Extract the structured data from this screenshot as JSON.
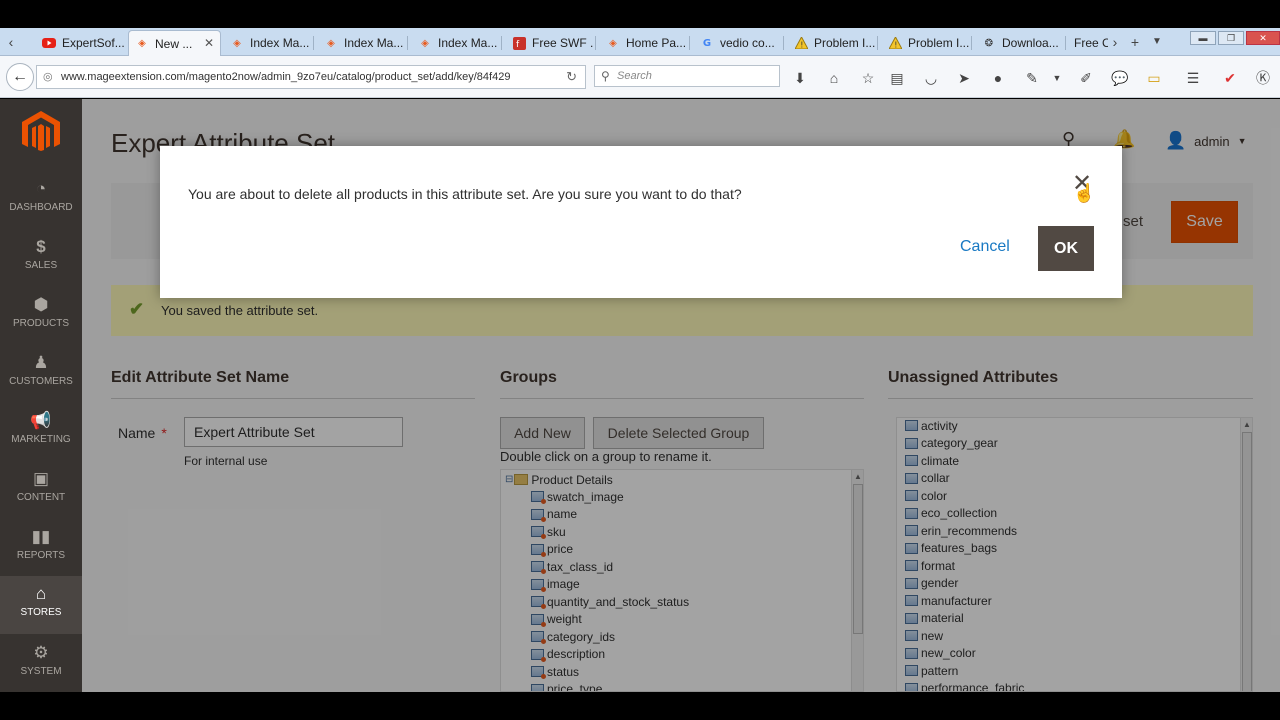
{
  "browser": {
    "tabs": [
      {
        "label": "ExpertSof...",
        "icon": "youtube-icon"
      },
      {
        "label": "New ...",
        "icon": "magento-icon"
      },
      {
        "label": "Index Ma...",
        "icon": "magento-icon"
      },
      {
        "label": "Index Ma...",
        "icon": "magento-icon"
      },
      {
        "label": "Index Ma...",
        "icon": "magento-icon"
      },
      {
        "label": "Free SWF ...",
        "icon": "flash-icon"
      },
      {
        "label": "Home Pa...",
        "icon": "magento-icon"
      },
      {
        "label": "vedio co...",
        "icon": "google-icon"
      },
      {
        "label": "Problem I...",
        "icon": "warning-icon"
      },
      {
        "label": "Problem I...",
        "icon": "warning-icon"
      },
      {
        "label": "Downloa...",
        "icon": "download-site-icon"
      },
      {
        "label": "Free C",
        "icon": ""
      }
    ],
    "url": "www.mageextension.com/magento2now/admin_9zo7eu/catalog/product_set/add/key/84f429",
    "search_placeholder": "Search"
  },
  "sidebar": {
    "items": [
      {
        "label": "DASHBOARD",
        "icon": "speedometer-icon"
      },
      {
        "label": "SALES",
        "icon": "dollar-icon"
      },
      {
        "label": "PRODUCTS",
        "icon": "cube-icon"
      },
      {
        "label": "CUSTOMERS",
        "icon": "person-icon"
      },
      {
        "label": "MARKETING",
        "icon": "megaphone-icon"
      },
      {
        "label": "CONTENT",
        "icon": "layout-icon"
      },
      {
        "label": "REPORTS",
        "icon": "bar-chart-icon"
      },
      {
        "label": "STORES",
        "icon": "store-icon"
      },
      {
        "label": "SYSTEM",
        "icon": "gear-icon"
      }
    ],
    "active": "STORES"
  },
  "header": {
    "title": "Expert Attribute Set",
    "user": "admin",
    "reset_label": "set",
    "save_label": "Save"
  },
  "message": "You saved the attribute set.",
  "edit_name": {
    "title": "Edit Attribute Set Name",
    "label": "Name",
    "required_mark": "*",
    "value": "Expert Attribute Set",
    "note": "For internal use"
  },
  "groups": {
    "title": "Groups",
    "add_new": "Add New",
    "delete_group": "Delete Selected Group",
    "hint": "Double click on a group to rename it.",
    "root": "Product Details",
    "items": [
      "swatch_image",
      "name",
      "sku",
      "price",
      "tax_class_id",
      "image",
      "quantity_and_stock_status",
      "weight",
      "category_ids",
      "description",
      "status",
      "price_type"
    ]
  },
  "unassigned": {
    "title": "Unassigned Attributes",
    "items": [
      "activity",
      "category_gear",
      "climate",
      "collar",
      "color",
      "eco_collection",
      "erin_recommends",
      "features_bags",
      "format",
      "gender",
      "manufacturer",
      "material",
      "new",
      "new_color",
      "pattern",
      "performance_fabric"
    ]
  },
  "dialog": {
    "message": "You are about to delete all products in this attribute set. Are you sure you want to do that?",
    "cancel": "Cancel",
    "ok": "OK"
  },
  "colors": {
    "accent": "#eb5202",
    "sidebar_bg": "#373330",
    "link": "#1979c3",
    "success_bg": "#fffbbb"
  }
}
